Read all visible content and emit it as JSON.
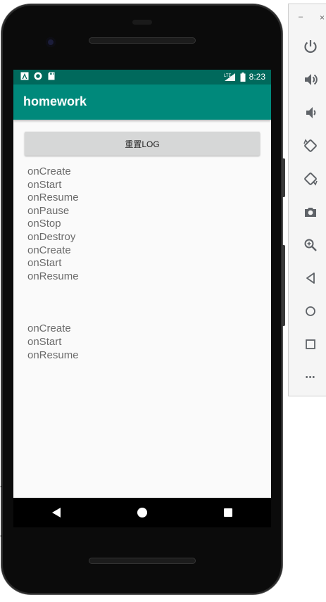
{
  "status_bar": {
    "time": "8:23",
    "network": "LTE",
    "background": "#00695c"
  },
  "app_bar": {
    "title": "homework",
    "background": "#00897b"
  },
  "reset_button": {
    "label": "重置LOG"
  },
  "log": {
    "lines_block1": [
      "onCreate",
      "onStart",
      "onResume",
      "onPause",
      "onStop",
      "onDestroy",
      "onCreate",
      "onStart",
      "onResume"
    ],
    "lines_block2": [
      "onCreate",
      "onStart",
      "onResume"
    ]
  },
  "nav": {
    "back_icon": "back-triangle-icon",
    "home_icon": "home-circle-icon",
    "recents_icon": "recents-square-icon"
  },
  "toolbar": {
    "minimize": "–",
    "close": "×",
    "more": "•••",
    "items": [
      "power-icon",
      "volume-up-icon",
      "volume-down-icon",
      "rotate-left-icon",
      "rotate-right-icon",
      "camera-icon",
      "zoom-icon",
      "back-icon",
      "home-icon",
      "overview-icon",
      "more-icon"
    ]
  }
}
